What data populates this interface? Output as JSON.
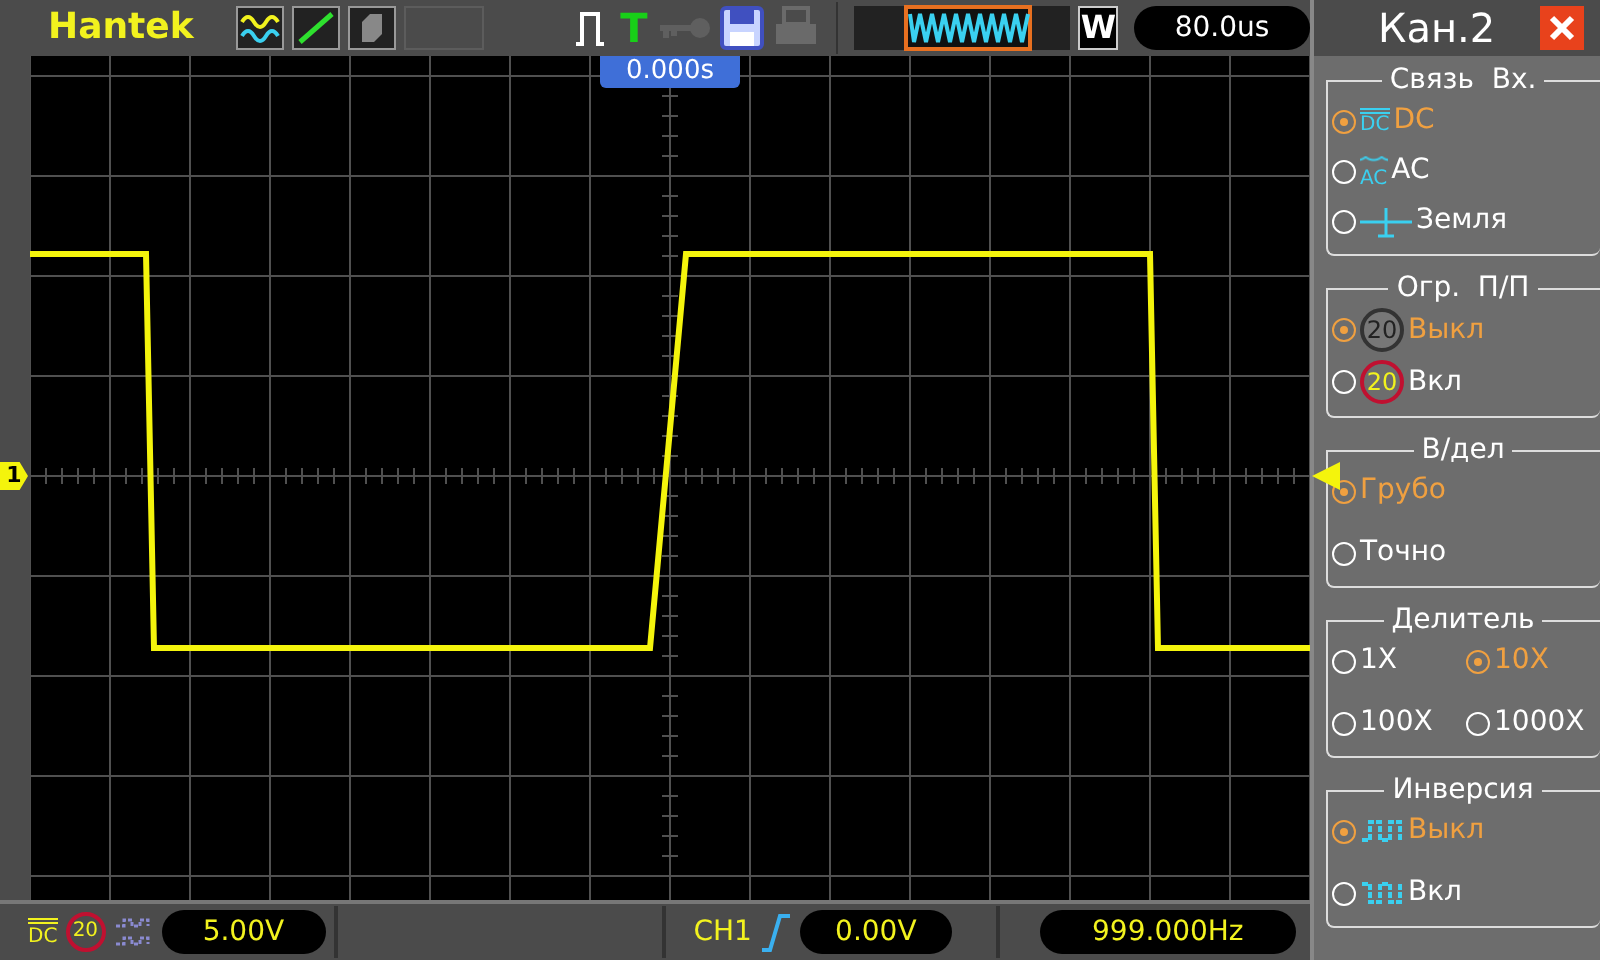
{
  "toolbar": {
    "brand": "Hantek",
    "trigger_mark": "T",
    "zoom_button": "W",
    "timebase": "80.0us"
  },
  "screen": {
    "trigger_time": "0.000s",
    "channel_marker": "1"
  },
  "panel": {
    "title": "Кан.2",
    "groups": [
      {
        "title": "Связь  Вх.",
        "kind": "list",
        "options": [
          {
            "label": "DC",
            "selected": true,
            "kind": "dc",
            "icon_text": "DC"
          },
          {
            "label": "AC",
            "selected": false,
            "kind": "ac",
            "icon_text": "AC"
          },
          {
            "label": "Земля",
            "selected": false,
            "kind": "ground"
          }
        ]
      },
      {
        "title": "Огр.  П/П",
        "kind": "list",
        "options": [
          {
            "label": "Выкл",
            "selected": true,
            "kind": "bw-off",
            "icon_text": "20"
          },
          {
            "label": "Вкл",
            "selected": false,
            "kind": "bw-on",
            "icon_text": "20"
          }
        ]
      },
      {
        "title": "В/дел",
        "kind": "list",
        "options": [
          {
            "label": "Грубо",
            "selected": true,
            "kind": "plain"
          },
          {
            "label": "Точно",
            "selected": false,
            "kind": "plain"
          }
        ]
      },
      {
        "title": "Делитель",
        "kind": "grid",
        "options": [
          {
            "label": "1X",
            "selected": false,
            "kind": "plain"
          },
          {
            "label": "10X",
            "selected": true,
            "kind": "plain"
          },
          {
            "label": "100X",
            "selected": false,
            "kind": "plain"
          },
          {
            "label": "1000X",
            "selected": false,
            "kind": "plain"
          }
        ]
      },
      {
        "title": "Инверсия",
        "kind": "list",
        "options": [
          {
            "label": "Выкл",
            "selected": true,
            "kind": "inv-off"
          },
          {
            "label": "Вкл",
            "selected": false,
            "kind": "inv-on"
          }
        ]
      }
    ]
  },
  "status_bar": {
    "coupling": "DC",
    "bw_limit": "20",
    "volts_div": "5.00V",
    "trigger_source": "CH1",
    "trigger_level": "0.00V",
    "frequency": "999.000Hz"
  }
}
